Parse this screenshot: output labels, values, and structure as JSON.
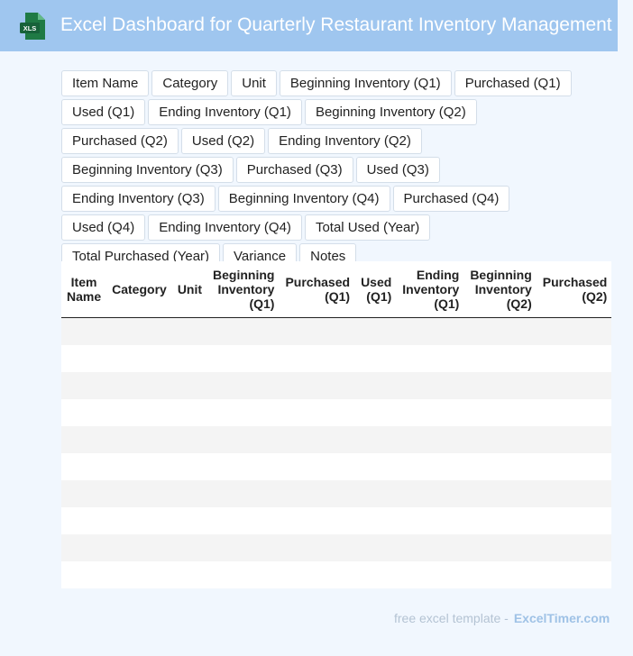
{
  "header": {
    "title": "Excel Dashboard for Quarterly Restaurant Inventory Management",
    "icon_label": "XLS",
    "icon": "excel-file-icon",
    "accent": "#9fc6ef",
    "icon_color": "#1f7a45"
  },
  "fields": [
    "Item Name",
    "Category",
    "Unit",
    "Beginning Inventory (Q1)",
    "Purchased (Q1)",
    "Used (Q1)",
    "Ending Inventory (Q1)",
    "Beginning Inventory (Q2)",
    "Purchased (Q2)",
    "Used (Q2)",
    "Ending Inventory (Q2)",
    "Beginning Inventory (Q3)",
    "Purchased (Q3)",
    "Used (Q3)",
    "Ending Inventory (Q3)",
    "Beginning Inventory (Q4)",
    "Purchased (Q4)",
    "Used (Q4)",
    "Ending Inventory (Q4)",
    "Total Used (Year)",
    "Total Purchased (Year)",
    "Variance",
    "Notes"
  ],
  "table": {
    "columns": [
      "Item Name",
      "Category",
      "Unit",
      "Beginning Inventory (Q1)",
      "Purchased (Q1)",
      "Used (Q1)",
      "Ending Inventory (Q1)",
      "Beginning Inventory (Q2)",
      "Purchased (Q2)"
    ],
    "rows": [
      [
        "",
        "",
        "",
        "",
        "",
        "",
        "",
        "",
        ""
      ],
      [
        "",
        "",
        "",
        "",
        "",
        "",
        "",
        "",
        ""
      ],
      [
        "",
        "",
        "",
        "",
        "",
        "",
        "",
        "",
        ""
      ],
      [
        "",
        "",
        "",
        "",
        "",
        "",
        "",
        "",
        ""
      ],
      [
        "",
        "",
        "",
        "",
        "",
        "",
        "",
        "",
        ""
      ],
      [
        "",
        "",
        "",
        "",
        "",
        "",
        "",
        "",
        ""
      ],
      [
        "",
        "",
        "",
        "",
        "",
        "",
        "",
        "",
        ""
      ],
      [
        "",
        "",
        "",
        "",
        "",
        "",
        "",
        "",
        ""
      ],
      [
        "",
        "",
        "",
        "",
        "",
        "",
        "",
        "",
        ""
      ],
      [
        "",
        "",
        "",
        "",
        "",
        "",
        "",
        "",
        ""
      ]
    ]
  },
  "footer": {
    "text": "free excel template -",
    "brand": "ExcelTimer.com"
  }
}
